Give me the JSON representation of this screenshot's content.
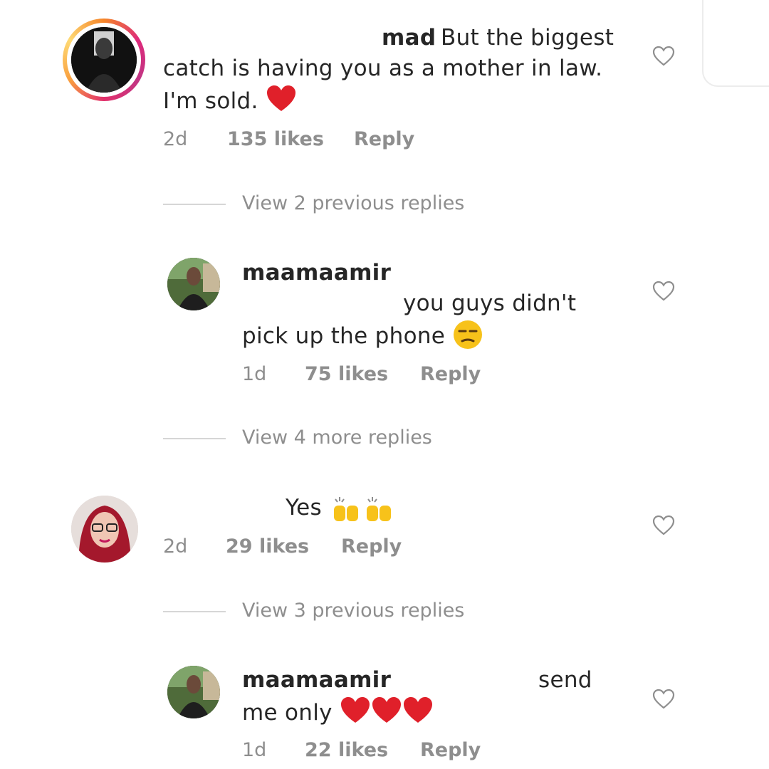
{
  "comments": [
    {
      "username": "mad",
      "text_line1": "But the biggest",
      "text_line2": "catch is having you as a mother in law.",
      "text_line3": "I'm sold.",
      "time": "2d",
      "likes": "135 likes",
      "reply": "Reply"
    },
    {
      "username": "maamaamir",
      "text_line1": "you guys didn't",
      "text_line2": "pick up the phone",
      "time": "1d",
      "likes": "75 likes",
      "reply": "Reply"
    },
    {
      "text": "Yes",
      "time": "2d",
      "likes": "29 likes",
      "reply": "Reply"
    },
    {
      "username": "maamaamir",
      "text_line1": "send",
      "text_line2": "me only",
      "time": "1d",
      "likes": "22 likes",
      "reply": "Reply"
    }
  ],
  "view_more": [
    "View 2 previous replies",
    "View 4 more replies",
    "View 3 previous replies"
  ],
  "icons": {
    "heart": "heart-outline-icon",
    "red_heart": "red-heart-emoji",
    "unamused": "unamused-face-emoji",
    "raising_hands": "raising-hands-emoji"
  },
  "colors": {
    "text": "#262626",
    "meta": "#8e8e8e",
    "heart_red": "#e0202a",
    "emoji_yellow": "#f7c21a"
  }
}
